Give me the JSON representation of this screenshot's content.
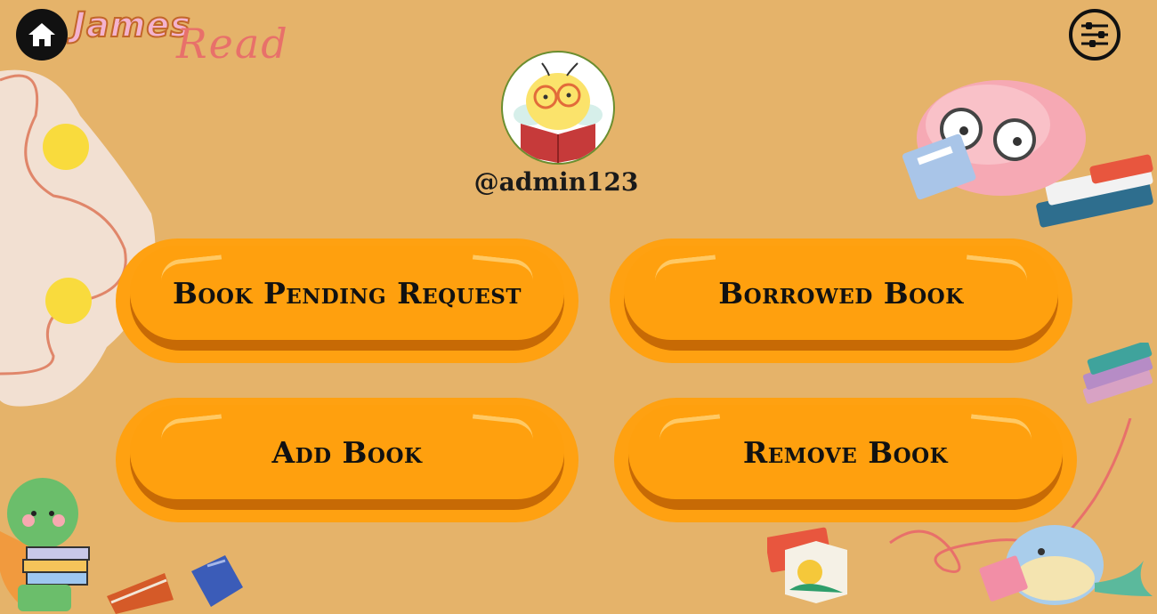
{
  "brand": {
    "first": "James",
    "second": "Read"
  },
  "profile": {
    "username": "@admin123"
  },
  "actions": [
    {
      "label": "Book Pending Request"
    },
    {
      "label": "Borrowed Book"
    },
    {
      "label": "Add Book"
    },
    {
      "label": "Remove Book"
    }
  ],
  "icons": {
    "home": "home-icon",
    "settings": "sliders-icon"
  },
  "colors": {
    "background": "#E5B36A",
    "button": "#FFA00E",
    "button_shadow": "#C76A05"
  }
}
